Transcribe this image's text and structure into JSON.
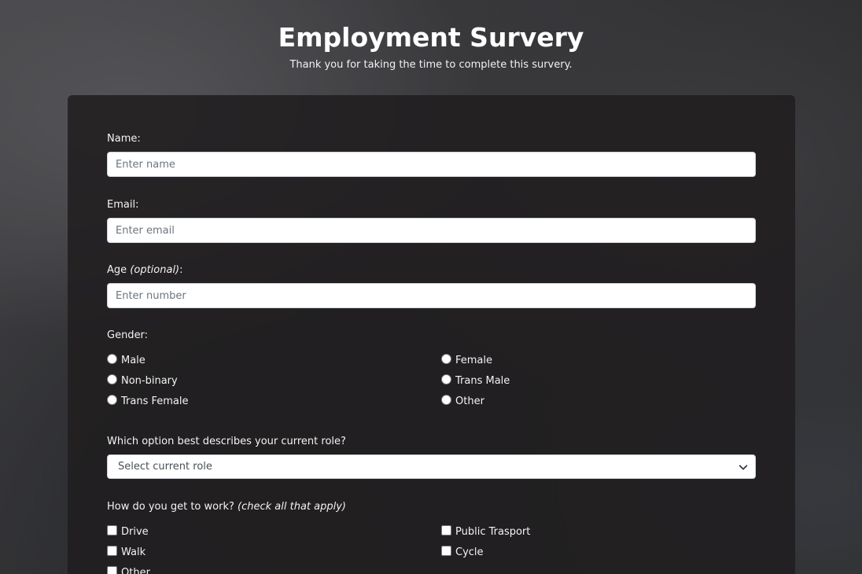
{
  "header": {
    "title": "Employment Survery",
    "description": "Thank you for taking the time to complete this survery."
  },
  "form": {
    "name": {
      "label": "Name:",
      "placeholder": "Enter name"
    },
    "email": {
      "label": "Email:",
      "placeholder": "Enter email"
    },
    "age": {
      "label": "Age",
      "label_optional": "(optional)",
      "label_suffix": ":",
      "placeholder": "Enter number"
    },
    "gender": {
      "label": "Gender:",
      "options": [
        "Male",
        "Female",
        "Non-binary",
        "Trans Male",
        "Trans Female",
        "Other"
      ]
    },
    "role": {
      "label": "Which option best describes your current role?",
      "selected": "Select current role"
    },
    "commute": {
      "label": "How do you get to work?",
      "label_note": "(check all that apply)",
      "options": [
        "Drive",
        "Public Trasport",
        "Walk",
        "Cycle",
        "Other"
      ]
    }
  },
  "colors": {
    "card_background": "#201e1f",
    "text": "#f4f4f4",
    "input_background": "#ffffff"
  }
}
